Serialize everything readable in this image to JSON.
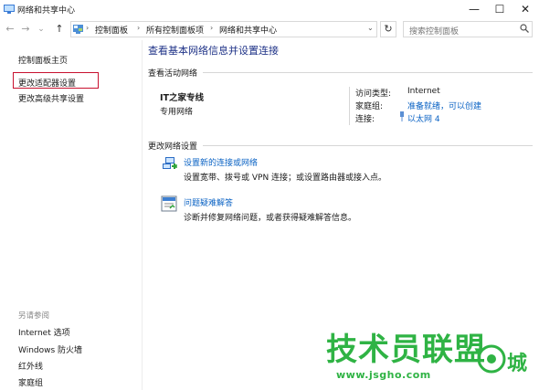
{
  "window": {
    "title": "网络和共享中心",
    "buttons": [
      "—",
      "☐",
      "✕"
    ]
  },
  "address_bar": {
    "crumbs": [
      "控制面板",
      "所有控制面板项",
      "网络和共享中心"
    ],
    "refresh_glyph": "↻",
    "search_placeholder": "搜索控制面板"
  },
  "nav_glyphs": {
    "back": "←",
    "forward": "→",
    "recent": "⌄",
    "up": "↑"
  },
  "sidebar": {
    "items": [
      "控制面板主页",
      "更改适配器设置",
      "更改高级共享设置"
    ],
    "highlighted_index": 1,
    "see_also_label": "另请参阅",
    "see_also": [
      "Internet 选项",
      "Windows 防火墙",
      "红外线",
      "家庭组"
    ]
  },
  "main": {
    "title": "查看基本网络信息并设置连接",
    "active_networks_label": "查看活动网络",
    "network": {
      "name": "IT之家专线",
      "type": "专用网络",
      "access_type_label": "访问类型:",
      "access_type_value": "Internet",
      "homegroup_label": "家庭组:",
      "homegroup_value": "准备就绪，可以创建",
      "connection_label": "连接:",
      "connection_value": "以太网 4"
    },
    "change_settings_label": "更改网络设置",
    "tasks": [
      {
        "title": "设置新的连接或网络",
        "desc": "设置宽带、拨号或 VPN 连接；或设置路由器或接入点。",
        "icon": "network-setup-icon"
      },
      {
        "title": "问题疑难解答",
        "desc": "诊断并修复网络问题，或者获得疑难解答信息。",
        "icon": "troubleshoot-icon"
      }
    ]
  },
  "watermark": {
    "title": "技术员联盟",
    "url": "www.jsgho.com",
    "city": "城"
  },
  "colors": {
    "link": "#0b63c4",
    "title": "#1e3287",
    "highlight": "#c8102e",
    "watermark": "#2fb344"
  }
}
